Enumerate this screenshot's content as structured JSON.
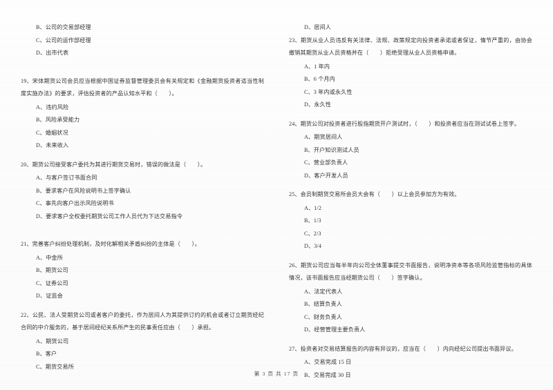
{
  "document": {
    "type": "scanned-exam-paper",
    "footer": "第 3 页 共 17 页"
  },
  "left_column": {
    "continued_options": [
      "B、公司的交易部经理",
      "C、公司的运作部经理",
      "D、出市代表"
    ],
    "questions": [
      {
        "number": "19",
        "stem": "19、宋体期货公司会员应当根据中国证券监督管理委员会有关规定和《金融期货投资者适当性制度实施办法》的要求，评估投资者的产品认知水平和（　　）。",
        "options": [
          "A、违约风险",
          "B、风险承受能力",
          "C、婚姻状况",
          "D、未来收入"
        ]
      },
      {
        "number": "20",
        "stem": "20、期货公司接受客户委托为其进行期货交易时，错误的做法是（　　）。",
        "options": [
          "A、与客户签订书面合同",
          "B、要求客户在风险说明书上签字确认",
          "C、事先向客户出示风险说明书",
          "D、要求客户全权委托期货公司工作人员代为下达交易指令"
        ]
      },
      {
        "number": "21",
        "stem": "21、完善客户纠纷处理机制，及时化解相关矛盾纠纷的主体是（　　）。",
        "options": [
          "A、中金所",
          "B、期货公司",
          "C、证券公司",
          "D、证监会"
        ]
      },
      {
        "number": "22",
        "stem": "22、公民、法人受期货公司或者客户的委托，作为居间人为其提供订约的机会或者订立期货经纪合同的中介服务的，基于居间经纪关系所产生的民事责任应由（　　）承担。",
        "options": [
          "A、期货公司",
          "B、客户",
          "C、期货交易所"
        ]
      }
    ]
  },
  "right_column": {
    "continued_options": [
      "D、居间人"
    ],
    "questions": [
      {
        "number": "23",
        "stem": "23、期货从业人员违反有关法律、法规、政策规定向投资者承诺或者保证，情节严重的，由协会撤销其期货从业人员资格并在（　　）拒绝受理从业人员资格申请。",
        "options": [
          "A、1 年内",
          "B、6 个月内",
          "C、3 年内或永久性",
          "D、永久性"
        ]
      },
      {
        "number": "24",
        "stem": "24、期货公司对投资者进行股指期货开户测试时，（　　）和投资者应当在测试试卷上签字。",
        "options": [
          "A、期货居间人",
          "B、开户知识测试人员",
          "C、营业部负责人",
          "D、客户开发人员"
        ]
      },
      {
        "number": "25",
        "stem": "25、会员制期货交易所会员大会有（　　）以上会员参加方为有效。",
        "options": [
          "A、1/2",
          "B、1/3",
          "C、2/3",
          "D、3/4"
        ]
      },
      {
        "number": "26",
        "stem": "26、期货公司应当每半年向公司全体董事提交书面报告，说明净资本等各项风险监管指标的具体情况，该书面报告应当经期货公司（　　）签字确认。",
        "options": [
          "A、法定代表人",
          "B、结算负责人",
          "C、财务负责人",
          "D、经营管理主要负责人"
        ]
      },
      {
        "number": "27",
        "stem": "27、投资者对交易结算报告的内容有异议的，应当在（　　）内向经纪公司提出书面异议。",
        "options": [
          "A、交易完成 15 日",
          "B、交易完成 30 日"
        ]
      }
    ]
  }
}
